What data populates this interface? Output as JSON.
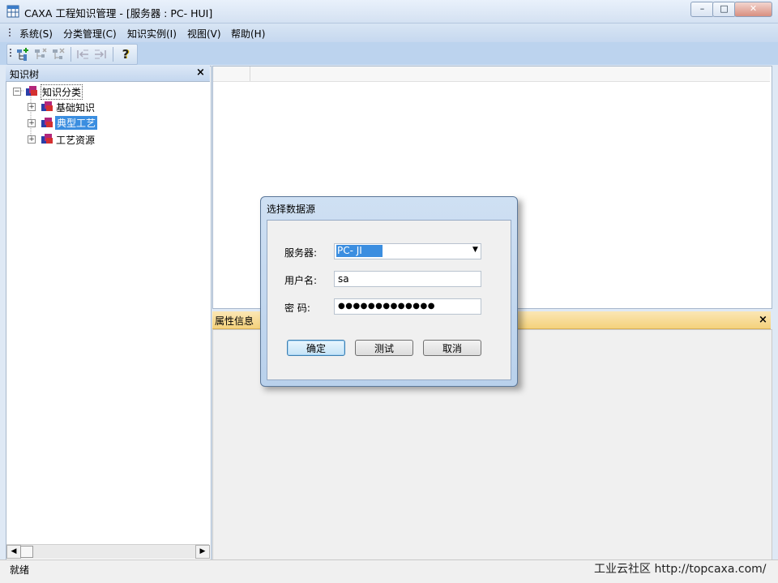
{
  "window": {
    "title": "CAXA 工程知识管理 - [服务器 : PC-      HUI]",
    "controls": {
      "minimize": "–",
      "maximize": "□",
      "close": "✕"
    }
  },
  "menu": [
    "系统(S)",
    "分类管理(C)",
    "知识实例(I)",
    "视图(V)",
    "帮助(H)"
  ],
  "toolbar": {
    "icons": [
      "add-node-icon",
      "add-child-icon",
      "delete-node-icon",
      "move-left-icon",
      "move-right-icon",
      "help-icon"
    ],
    "help_glyph": "?"
  },
  "tree_panel": {
    "title": "知识树",
    "close": "×",
    "root": "知识分类",
    "children": [
      {
        "label": "基础知识",
        "selected": false
      },
      {
        "label": "典型工艺",
        "selected": true
      },
      {
        "label": "工艺资源",
        "selected": false
      }
    ],
    "expand_glyph": "+",
    "collapse_glyph": "−"
  },
  "property_panel": {
    "title": "属性信息",
    "close": "×"
  },
  "status": {
    "text": "就绪",
    "watermark": "工业云社区 http://topcaxa.com/"
  },
  "dialog": {
    "title": "选择数据源",
    "server_label": "服务器:",
    "server_value": "PC-       JI",
    "user_label": "用户名:",
    "user_value": "sa",
    "password_label": "密 码:",
    "password_value": "●●●●●●●●●●●●●",
    "ok": "确定",
    "test": "测试",
    "cancel": "取消"
  },
  "colors": {
    "selection": "#3b8ee0",
    "property_header": "#f4d27c",
    "menu_bar": "#c6d8ef"
  }
}
